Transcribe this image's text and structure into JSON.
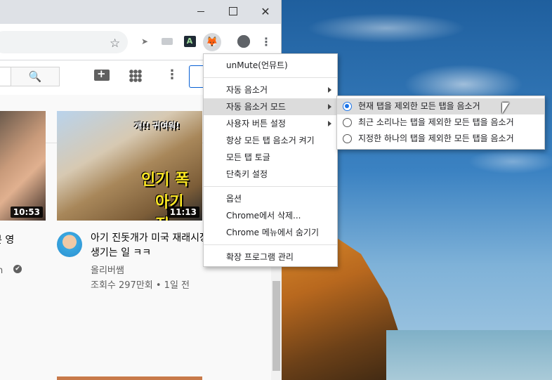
{
  "window": {
    "minimize_icon": "minimize-icon",
    "maximize_icon": "maximize-icon",
    "close_glyph": "✕"
  },
  "toolbar": {
    "star_glyph": "☆",
    "ext1_glyph": "➤",
    "unmute_glyph": "🦊",
    "menu_glyph": "⋮"
  },
  "youtube": {
    "search_glyph": "🔍",
    "more_glyph": "⋮",
    "videos": [
      {
        "title": "본 영",
        "channel": "an",
        "duration": "10:53"
      },
      {
        "title": "아기 진돗개가 미국 재래시장에 가면 생기는 일 ㅋㅋ",
        "channel": "올리버쌤",
        "meta": "조회수 297만회 • 1일 전",
        "duration": "11:13",
        "thumb_text_1": "인기 폭",
        "thumb_text_2": "아기 진",
        "thumb_tag": "개!! 귀여워!"
      }
    ]
  },
  "context_menu": {
    "header": "unMute(언뮤트)",
    "items": [
      {
        "label": "자동 음소거",
        "has_submenu": true
      },
      {
        "label": "자동 음소거 모드",
        "has_submenu": true,
        "highlighted": true
      },
      {
        "label": "사용자 버튼 설정",
        "has_submenu": true
      },
      {
        "label": "항상 모든 탭 음소거 켜기"
      },
      {
        "label": "모든 탭 토글"
      },
      {
        "label": "단축키 설정"
      }
    ],
    "group2": [
      {
        "label": "옵션"
      },
      {
        "label": "Chrome에서 삭제..."
      },
      {
        "label": "Chrome 메뉴에서 숨기기"
      }
    ],
    "group3": [
      {
        "label": "확장 프로그램 관리"
      }
    ]
  },
  "submenu": {
    "options": [
      {
        "label": "현재 탭을 제외한 모든 탭을 음소거",
        "selected": true
      },
      {
        "label": "최근 소리나는 탭을 제외한 모든 탭을 음소거",
        "selected": false
      },
      {
        "label": "지정한 하나의 탭을 제외한 모든 탭을 음소거",
        "selected": false
      }
    ]
  },
  "colors": {
    "accent": "#1a73e8",
    "highlight": "#dcdcdc"
  }
}
